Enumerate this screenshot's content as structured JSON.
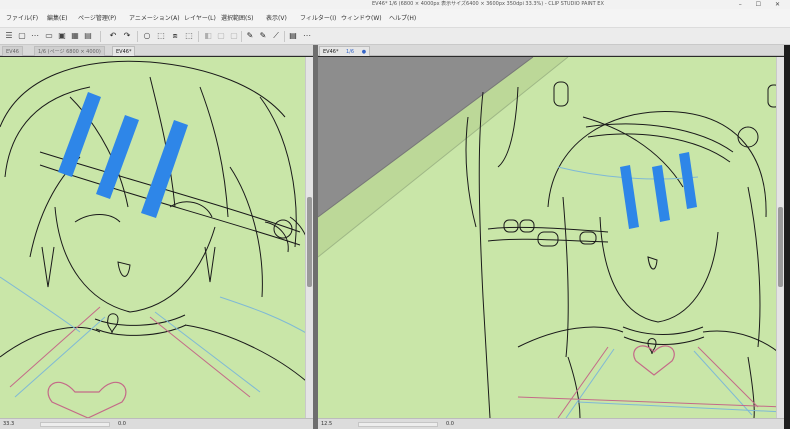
{
  "window": {
    "title": "EV46* 1/6 (6800 × 4000px 表示サイズ6400 × 3600px 350dpi 33.3%) - CLIP STUDIO PAINT EX",
    "controls": "– ☐ ✕"
  },
  "menu": [
    "ファイル(F)",
    "編集(E)",
    "ページ管理(P)",
    "アニメーション(A)",
    "レイヤー(L)",
    "選択範囲(S)",
    "表示(V)",
    "フィルター(I)",
    "ウィンドウ(W)",
    "ヘルプ(H)"
  ],
  "toolbar": {
    "icons": [
      "menu-icon",
      "new-canvas-icon",
      "open-icon",
      "save-icon",
      "print-icon",
      "undo-icon",
      "redo-icon",
      "select-icon",
      "crop-icon",
      "rotate-icon",
      "transform-icon",
      "fill-icon",
      "pen-icon",
      "brush-icon",
      "eraser-icon",
      "ruler-icon",
      "document-icon"
    ],
    "glyphs": {
      "menu": "☰",
      "undo": "↶",
      "redo": "↷",
      "select": "⬚",
      "pen": "✎",
      "ruler": "⟋",
      "doc": "▤",
      "save": "▣",
      "open": "▭",
      "print": "▦",
      "new": "▢",
      "circle": "○",
      "transform": "⧈",
      "fill": "◧",
      "more": "⋯"
    }
  },
  "left_pane": {
    "tabs": [
      {
        "label": "EV46"
      },
      {
        "label": "1/6 (ページ 6800 × 4000)"
      },
      {
        "label": "EV46*"
      }
    ],
    "status": {
      "zoom": "33.3",
      "angle": "0.0"
    }
  },
  "right_pane": {
    "tabs": [
      {
        "label": "EV46*",
        "detail": "1/6",
        "close": "●"
      }
    ],
    "status": {
      "zoom": "12.5",
      "angle": "0.0"
    }
  },
  "colors": {
    "canvas_bg": "#c9e6a8",
    "line_art": "#1a1a1a",
    "censor_bar": "#2e86e8",
    "guide_pink": "#c46a88",
    "guide_blue": "#7fb9d6",
    "pasteboard": "#8d8d8d",
    "paper_band": "#bcd898"
  }
}
